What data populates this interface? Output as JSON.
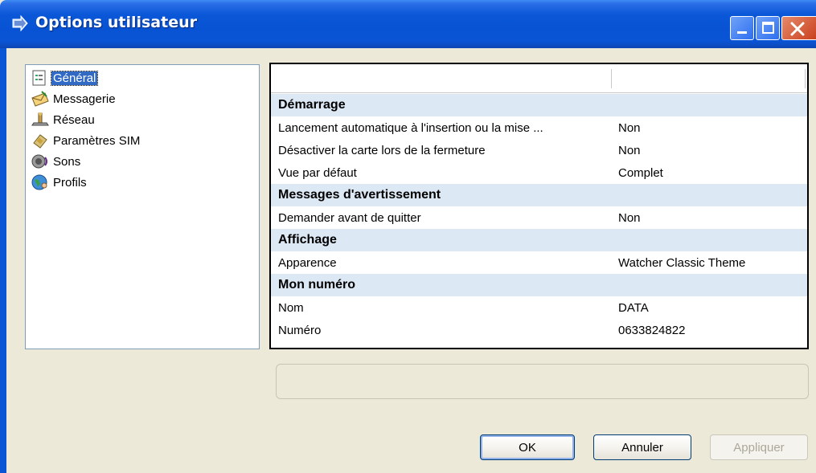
{
  "window": {
    "title": "Options utilisateur",
    "icon": "app-arrow-icon",
    "colors": {
      "titlebar": "#0a57d8",
      "selection": "#316ac5",
      "category": "#dde8f5"
    }
  },
  "tree": {
    "items": [
      {
        "label": "Général",
        "icon": "document-icon",
        "selected": true
      },
      {
        "label": "Messagerie",
        "icon": "envelope-icon",
        "selected": false
      },
      {
        "label": "Réseau",
        "icon": "network-icon",
        "selected": false
      },
      {
        "label": "Paramètres SIM",
        "icon": "sim-card-icon",
        "selected": false
      },
      {
        "label": "Sons",
        "icon": "speaker-icon",
        "selected": false
      },
      {
        "label": "Profils",
        "icon": "globe-user-icon",
        "selected": false
      }
    ]
  },
  "grid": {
    "rows": [
      {
        "type": "category",
        "label": "Démarrage"
      },
      {
        "type": "property",
        "label": "Lancement automatique à l'insertion ou la mise ...",
        "value": "Non"
      },
      {
        "type": "property",
        "label": "Désactiver la carte lors de la fermeture",
        "value": "Non"
      },
      {
        "type": "property",
        "label": "Vue par défaut",
        "value": "Complet"
      },
      {
        "type": "category",
        "label": "Messages d'avertissement"
      },
      {
        "type": "property",
        "label": "Demander avant de quitter",
        "value": "Non"
      },
      {
        "type": "category",
        "label": "Affichage"
      },
      {
        "type": "property",
        "label": "Apparence",
        "value": "Watcher Classic Theme"
      },
      {
        "type": "category",
        "label": "Mon numéro"
      },
      {
        "type": "property",
        "label": "Nom",
        "value": "DATA"
      },
      {
        "type": "property",
        "label": "Numéro",
        "value": "0633824822"
      }
    ]
  },
  "buttons": {
    "ok": "OK",
    "cancel": "Annuler",
    "apply": "Appliquer",
    "apply_enabled": false
  }
}
